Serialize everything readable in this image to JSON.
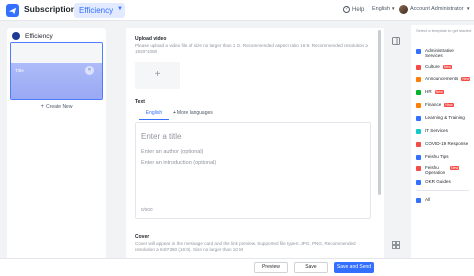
{
  "header": {
    "app_title": "Subscriptions",
    "space_name": "Efficiency",
    "help_label": "Help",
    "language": "English",
    "account": "Account Administrator"
  },
  "left_panel": {
    "channel_name": "Efficiency",
    "card_title": "Title",
    "create_new": "Create New"
  },
  "editor": {
    "upload_video_label": "Upload video",
    "upload_video_hint": "Please upload a video file of size no larger than 1 G. Recommended aspect ratio 16:9. Recommended resolution ≥ 1920*1080",
    "text_label": "Text",
    "tab_english": "English",
    "tab_more": "More languages",
    "title_placeholder": "Enter a title",
    "author_placeholder": "Enter an author (optional)",
    "intro_placeholder": "Enter an introduction (optional)",
    "counter": "0/500",
    "cover_label": "Cover",
    "cover_hint": "Cover will appear in the message card and the link preview. Supported file types: JPG, PNG. Recommended resolution ≥ 640*360 (16:9). Size no larger than 10 M"
  },
  "right_panel": {
    "hint": "Select a template to get started",
    "templates": [
      {
        "label": "Administrative Services",
        "color": "#3370ff",
        "new": false
      },
      {
        "label": "Culture",
        "color": "#f54a45",
        "new": true
      },
      {
        "label": "Announcements",
        "color": "#ff7d00",
        "new": true
      },
      {
        "label": "HR",
        "color": "#00b42a",
        "new": true
      },
      {
        "label": "Finance",
        "color": "#ff7d00",
        "new": true
      },
      {
        "label": "Learning & Training",
        "color": "#3370ff",
        "new": false
      },
      {
        "label": "IT Services",
        "color": "#14c9c9",
        "new": false
      },
      {
        "label": "COVID-19 Response",
        "color": "#f54a45",
        "new": false
      },
      {
        "label": "Feishu Tips",
        "color": "#3370ff",
        "new": false
      },
      {
        "label": "Feishu Operation",
        "color": "#f54a45",
        "new": true
      },
      {
        "label": "OKR Guides",
        "color": "#3370ff",
        "new": false
      },
      {
        "label": "All",
        "color": "#3370ff",
        "new": false
      }
    ],
    "new_badge": "New"
  },
  "footer": {
    "preview": "Preview",
    "save": "Save",
    "save_and_send": "Save and Send"
  },
  "colors": {
    "accent": "#3370ff",
    "badge": "#f54a45"
  }
}
